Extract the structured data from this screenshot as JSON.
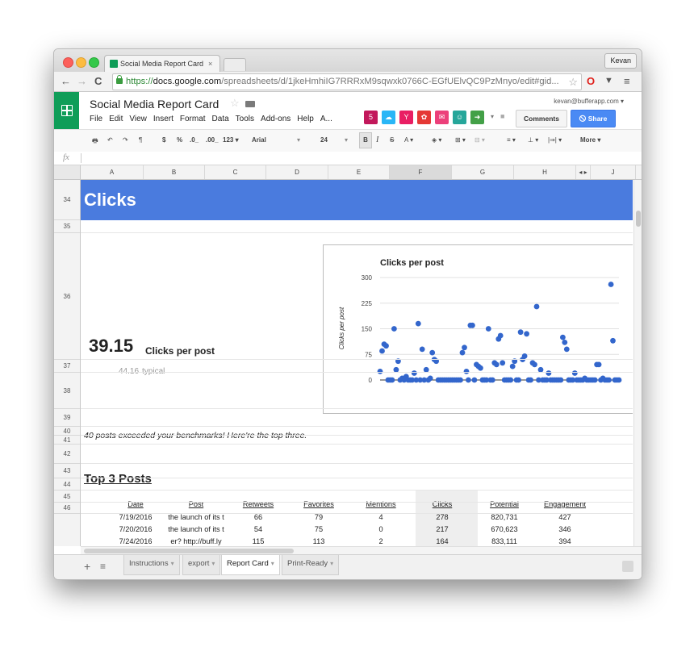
{
  "browser": {
    "tab_title": "Social Media Report Card",
    "tab_close": "×",
    "user": "Kevan",
    "url_https": "https://",
    "url_host": "docs.google.com",
    "url_path": "/spreadsheets/d/1jkeHmhiIG7RRRxM9sqwxk0766C-EGfUElvQC9PzMnyo/edit#gid...",
    "nav_back": "←",
    "nav_forward": "→",
    "nav_reload": "C",
    "bookmark_star": "☆",
    "ext_opera": "O",
    "ext_pocket": "▼",
    "menu_icon": "≡"
  },
  "app": {
    "doc_title": "Social Media Report Card",
    "title_star": "☆",
    "account": "kevan@bufferapp.com",
    "account_arrow": "▾",
    "menu": [
      "File",
      "Edit",
      "View",
      "Insert",
      "Format",
      "Data",
      "Tools",
      "Add-ons",
      "Help",
      "A..."
    ],
    "comments_label": "Comments",
    "share_label": "Share",
    "addon_colors": [
      "#c2185b",
      "#29b6f6",
      "#e91e63",
      "#e53935",
      "#ec407a",
      "#26a69a",
      "#43a047"
    ],
    "addon_dropdown": "▾",
    "chat_icon": "■"
  },
  "toolbar": {
    "print": "🖶",
    "undo": "↶",
    "redo": "↷",
    "paint": "¶",
    "currency": "$",
    "percent": "%",
    "dec_less": ".0_",
    "dec_more": ".00_",
    "format_123": "123 ▾",
    "font": "Arial",
    "font_arrow": "▾",
    "size": "24",
    "size_arrow": "▾",
    "bold": "B",
    "italic": "I",
    "strike": "S",
    "text_color": "A ▾",
    "fill": "◈ ▾",
    "borders": "⊞ ▾",
    "merge": "⊟ ▾",
    "halign": "≡ ▾",
    "valign": "⊥ ▾",
    "wrap": "|⇒| ▾",
    "more": "More ▾"
  },
  "formula_bar": {
    "fx": "fx"
  },
  "columns": [
    "A",
    "B",
    "C",
    "D",
    "E",
    "F",
    "G",
    "H",
    "◂ ▸",
    "J"
  ],
  "rows": [
    "34",
    "35",
    "36",
    "37",
    "38",
    "39",
    "40",
    "41",
    "42",
    "43",
    "44",
    "45",
    "46"
  ],
  "sheet": {
    "banner_title": "Clicks",
    "metric_value": "39.15",
    "metric_label": "Clicks per post",
    "typical_value": "44.16",
    "typical_label": "typical",
    "benchmark_message": "40 posts exceeded your benchmarks! Here're the top three.",
    "top_posts_title": "Top 3 Posts"
  },
  "table": {
    "headers": [
      "Date",
      "Post",
      "Retweets",
      "Favorites",
      "Mentions",
      "Clicks",
      "Potential",
      "Engagement"
    ],
    "rows": [
      [
        "7/19/2016",
        "the launch of its t",
        "66",
        "79",
        "4",
        "278",
        "820,731",
        "427"
      ],
      [
        "7/20/2016",
        "the launch of its t",
        "54",
        "75",
        "0",
        "217",
        "670,623",
        "346"
      ],
      [
        "7/24/2016",
        "er? http://buff.ly",
        "115",
        "113",
        "2",
        "164",
        "833,111",
        "394"
      ]
    ]
  },
  "chart_data": {
    "type": "scatter",
    "title": "Clicks per post",
    "xlabel": "",
    "ylabel": "Clicks per post",
    "ylim": [
      0,
      300
    ],
    "yticks": [
      0,
      75,
      150,
      225,
      300
    ],
    "grid": true,
    "legend": "none",
    "color": "#3366cc",
    "x": [
      1,
      2,
      3,
      4,
      5,
      6,
      7,
      8,
      9,
      10,
      11,
      12,
      13,
      14,
      15,
      16,
      17,
      18,
      19,
      20,
      21,
      22,
      23,
      24,
      25,
      26,
      27,
      28,
      29,
      30,
      31,
      32,
      33,
      34,
      35,
      36,
      37,
      38,
      39,
      40,
      41,
      42,
      43,
      44,
      45,
      46,
      47,
      48,
      49,
      50,
      51,
      52,
      53,
      54,
      55,
      56,
      57,
      58,
      59,
      60,
      61,
      62,
      63,
      64,
      65,
      66,
      67,
      68,
      69,
      70,
      71,
      72,
      73,
      74,
      75,
      76,
      77,
      78,
      79,
      80,
      81,
      82,
      83,
      84,
      85,
      86,
      87,
      88,
      89,
      90,
      91,
      92,
      93,
      94,
      95,
      96,
      97,
      98,
      99,
      100,
      101,
      102,
      103,
      104,
      105,
      106,
      107,
      108,
      109,
      110,
      111,
      112,
      113,
      114,
      115,
      116,
      117,
      118,
      119,
      120
    ],
    "y": [
      25,
      85,
      105,
      100,
      0,
      0,
      0,
      150,
      30,
      55,
      0,
      5,
      0,
      10,
      0,
      0,
      0,
      20,
      0,
      165,
      0,
      90,
      0,
      30,
      0,
      5,
      80,
      60,
      55,
      0,
      0,
      0,
      0,
      0,
      0,
      0,
      0,
      0,
      0,
      0,
      0,
      80,
      95,
      25,
      0,
      160,
      160,
      0,
      45,
      40,
      35,
      0,
      0,
      0,
      150,
      0,
      0,
      50,
      45,
      120,
      130,
      50,
      0,
      0,
      0,
      0,
      40,
      55,
      0,
      0,
      140,
      60,
      70,
      135,
      0,
      0,
      50,
      45,
      215,
      0,
      30,
      0,
      0,
      0,
      20,
      0,
      0,
      0,
      0,
      0,
      0,
      125,
      110,
      90,
      0,
      0,
      0,
      20,
      0,
      0,
      0,
      0,
      5,
      0,
      0,
      0,
      0,
      0,
      45,
      45,
      0,
      5,
      0,
      0,
      0,
      280,
      115,
      0,
      0,
      0
    ]
  },
  "sheet_tabs": [
    {
      "label": "Instructions",
      "arrow": "▾"
    },
    {
      "label": "export",
      "arrow": "▾"
    },
    {
      "label": "Report Card",
      "arrow": "▾"
    },
    {
      "label": "Print-Ready",
      "arrow": "▾"
    }
  ],
  "bottom": {
    "add": "+",
    "list": "≡"
  }
}
